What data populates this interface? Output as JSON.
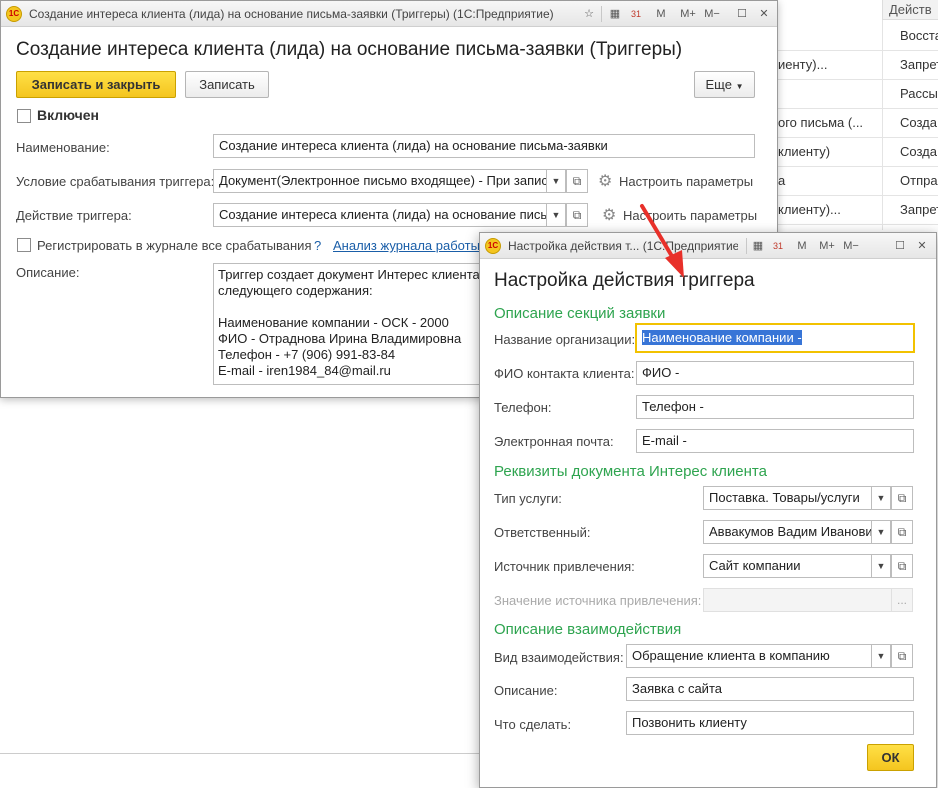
{
  "background": {
    "header": "Действ",
    "rows": [
      {
        "c1": "",
        "c2": "Восста"
      },
      {
        "c1": "иенту)...",
        "c2": "Запрет"
      },
      {
        "c1": "",
        "c2": "Рассы"
      },
      {
        "c1": "ого письма (...",
        "c2": "Созда"
      },
      {
        "c1": "клиенту)",
        "c2": "Созда"
      },
      {
        "c1": "а",
        "c2": "Отпра"
      },
      {
        "c1": "клиенту)...",
        "c2": "Запрет"
      }
    ]
  },
  "main": {
    "window_title": "Создание интереса клиента (лида) на основание письма-заявки (Триггеры)  (1С:Предприятие)",
    "toolbar_icons": [
      "☆",
      "▦",
      "31",
      "M",
      "M+",
      "M−",
      "☐",
      "✕"
    ],
    "heading": "Создание интереса клиента (лида) на основание письма-заявки (Триггеры)",
    "save_close": "Записать и закрыть",
    "save": "Записать",
    "more": "Еще",
    "enabled_label": "Включен",
    "name_label": "Наименование:",
    "name_value": "Создание интереса клиента (лида) на основание письма-заявки",
    "condition_label": "Условие срабатывания триггера:",
    "condition_value": "Документ(Электронное письмо входящее) - При запис",
    "action_label": "Действие триггера:",
    "action_value": "Создание интереса клиента (лида) на основание письм",
    "configure": "Настроить  параметры",
    "register_label": "Регистрировать в журнале все срабатывания",
    "help": "?",
    "journal_link": "Анализ журнала работы",
    "description_label": "Описание:",
    "description_lines": [
      "Триггер создает документ Интерес клиента",
      "следующего содержания:",
      "",
      "Наименование компании - ОСК - 2000",
      "ФИО - Отраднова Ирина Владимировна",
      "Телефон - +7 (906) 991-83-84",
      "E-mail - iren1984_84@mail.ru"
    ]
  },
  "dialog": {
    "window_title": "Настройка действия т...  (1С:Предприятие)",
    "toolbar_icons": [
      "▦",
      "31",
      "M",
      "M+",
      "M−",
      "☐",
      "✕"
    ],
    "heading": "Настройка действия триггера",
    "section1": "Описание секций заявки",
    "org_label": "Название организации:",
    "org_value": "Наименование компании -",
    "fio_label": "ФИО контакта клиента:",
    "fio_value": "ФИО -",
    "phone_label": "Телефон:",
    "phone_value": "Телефон -",
    "email_label": "Электронная почта:",
    "email_value": "E-mail -",
    "section2": "Реквизиты документа Интерес клиента",
    "service_label": "Тип услуги:",
    "service_value": "Поставка. Товары/услуги",
    "responsible_label": "Ответственный:",
    "responsible_value": "Аввакумов Вадим Иванови",
    "source_label": "Источник привлечения:",
    "source_value": "Сайт компании",
    "source_value_label": "Значение источника привлечения:",
    "ellipsis": "...",
    "section3": "Описание взаимодействия",
    "interaction_label": "Вид взаимодействия:",
    "interaction_value": "Обращение клиента в компанию",
    "desc_label": "Описание:",
    "desc_value": "Заявка с сайта",
    "todo_label": "Что сделать:",
    "todo_value": "Позвонить клиенту",
    "ok": "ОК"
  },
  "colors": {
    "accent_yellow": "#f4c51f",
    "section_green": "#2ea44f",
    "link_blue": "#1a5ea8",
    "arrow_red": "#e8302a",
    "selection_blue": "#3875d7"
  }
}
